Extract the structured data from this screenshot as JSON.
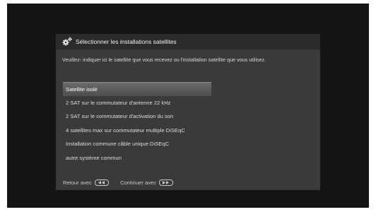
{
  "dialog": {
    "title": "Sélectionner les installations satellites",
    "instruction": "Veuillez- indiquer ici le satellite que vous recevez ou l'installation satellite que vous utilisez."
  },
  "options": [
    {
      "label": "Satellite isolé",
      "selected": true
    },
    {
      "label": "2 SAT sur le commutateur d'antenne 22 kHz",
      "selected": false
    },
    {
      "label": "2 SAT sur le commutateur d'activation du son",
      "selected": false
    },
    {
      "label": "4 satellites max sur commutateur multiple DiSEqC",
      "selected": false
    },
    {
      "label": "Installation commune câble unique DiSEqC",
      "selected": false
    },
    {
      "label": "autre système commun",
      "selected": false
    }
  ],
  "footer": {
    "back_label": "Retour avec",
    "continue_label": "Continuer avec",
    "back_icon": "rewind-button-icon",
    "continue_icon": "forward-button-icon"
  },
  "colors": {
    "screen_background": "#141414",
    "dialog_background": "#3a3a3a",
    "header_background": "#2b2b2b",
    "selected_highlight": "#5c5c5c"
  }
}
